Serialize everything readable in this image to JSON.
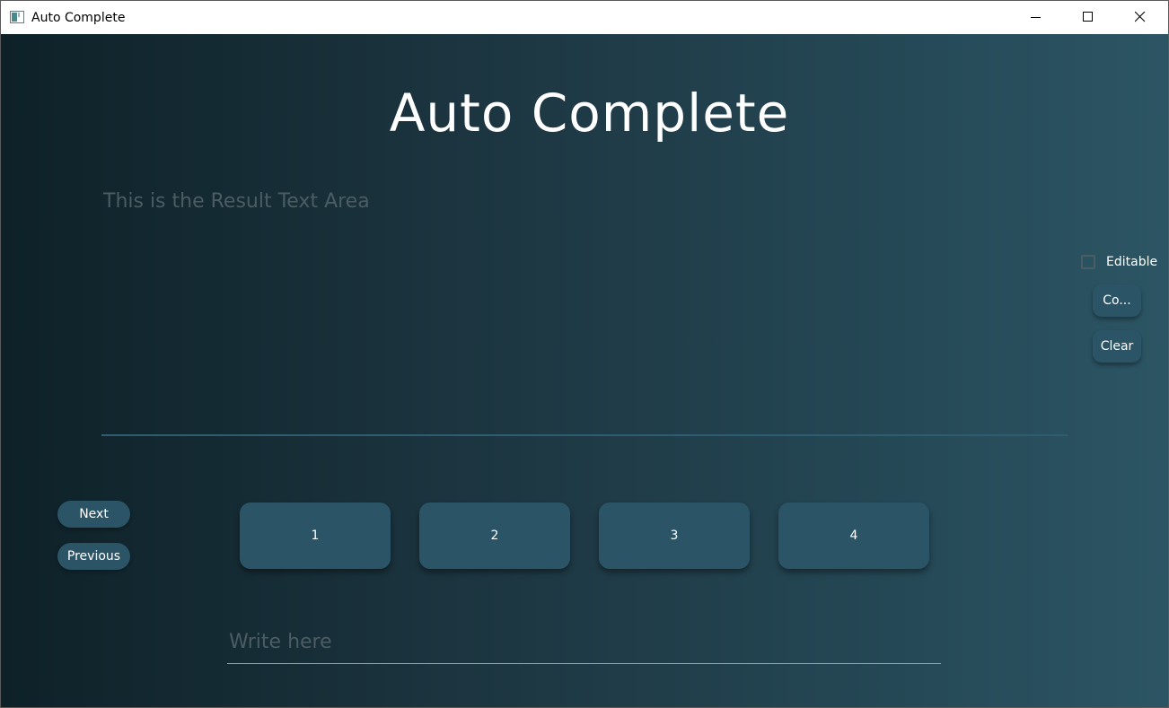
{
  "window": {
    "title": "Auto Complete"
  },
  "titlebar_buttons": {
    "minimize_icon": "minimize-icon",
    "maximize_icon": "maximize-icon",
    "close_icon": "close-icon"
  },
  "main": {
    "heading": "Auto Complete",
    "result_placeholder": "This is the Result Text Area",
    "result_value": ""
  },
  "side_panel": {
    "editable_label": "Editable",
    "editable_checked": false,
    "copy_label": "Co...",
    "clear_label": "Clear"
  },
  "navigation": {
    "next_label": "Next",
    "previous_label": "Previous"
  },
  "suggestions": [
    "1",
    "2",
    "3",
    "4"
  ],
  "input": {
    "placeholder": "Write here",
    "value": ""
  },
  "colors": {
    "gradient_start": "#0e2128",
    "gradient_end": "#2c5564",
    "button_bg": "#2b5567",
    "placeholder_text": "#4b5c62",
    "text": "#ffffff"
  }
}
